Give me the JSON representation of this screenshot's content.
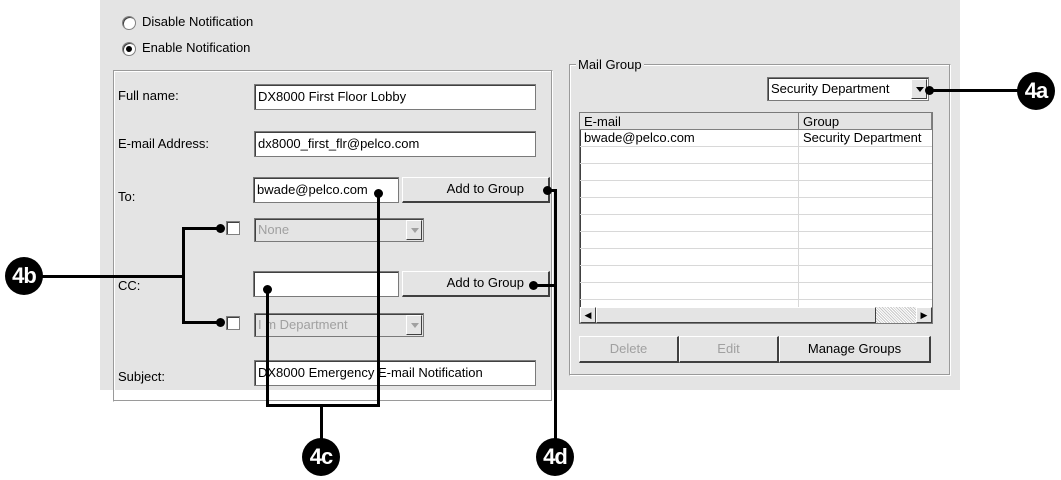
{
  "notification": {
    "disable_label": "Disable Notification",
    "enable_label": "Enable Notification",
    "selected": "enable"
  },
  "form": {
    "full_name_label": "Full name:",
    "full_name_value": "DX8000 First Floor Lobby",
    "email_label": "E-mail Address:",
    "email_value": "dx8000_first_flr@pelco.com",
    "to_label": "To:",
    "to_value": "bwade@pelco.com",
    "to_add_button": "Add to Group",
    "to_group_select": "None",
    "cc_label": "CC:",
    "cc_value": "",
    "cc_add_button": "Add to Group",
    "cc_group_select": "I m Department",
    "subject_label": "Subject:",
    "subject_value": "DX8000 Emergency E-mail Notification"
  },
  "mail_group": {
    "title": "Mail Group",
    "group_select": "Security Department",
    "columns": [
      "E-mail",
      "Group"
    ],
    "rows": [
      [
        "bwade@pelco.com",
        "Security Department"
      ]
    ],
    "delete_button": "Delete",
    "edit_button": "Edit",
    "manage_button": "Manage Groups"
  },
  "callouts": {
    "a": "4a",
    "b": "4b",
    "c": "4c",
    "d": "4d"
  },
  "icons": {
    "scroll_left": "scroll-left-icon",
    "scroll_right": "scroll-right-icon",
    "dropdown": "chevron-down-icon"
  }
}
